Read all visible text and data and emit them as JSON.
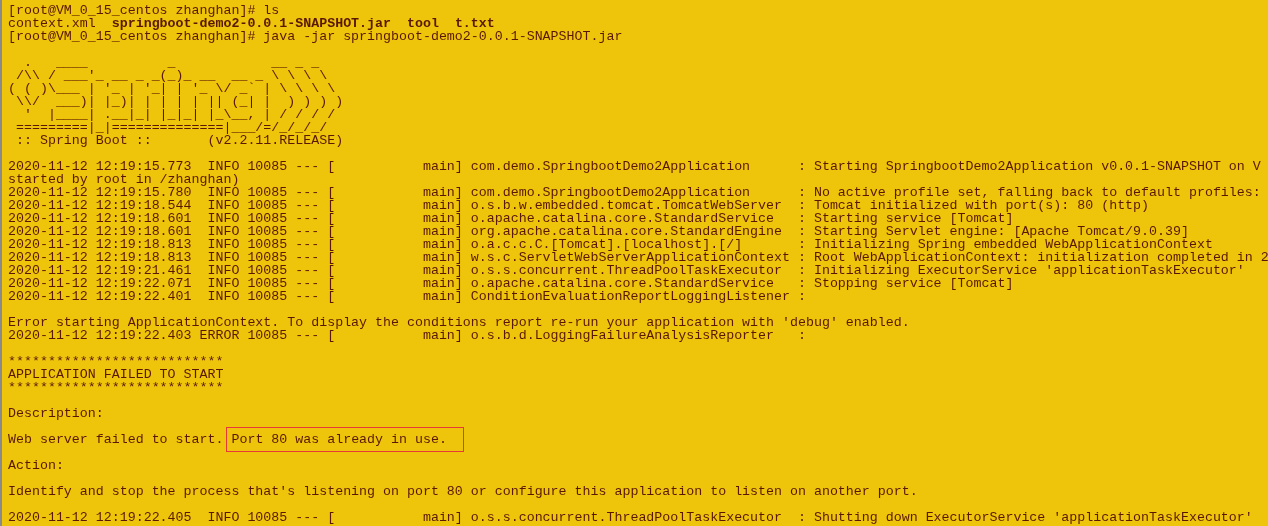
{
  "terminal": {
    "blocks": [
      {
        "lines": [
          {
            "text": "[root@VM_0_15_centos zhanghan]# ls"
          },
          {
            "text": "context.xml  **springboot-demo2-0.0.1-SNAPSHOT.jar**  **tool**  **t.txt**",
            "rich": true
          },
          {
            "text": "[root@VM_0_15_centos zhanghan]# java -jar springboot-demo2-0.0.1-SNAPSHOT.jar"
          }
        ]
      },
      {
        "lines": [
          {
            "text": "  .   ____          _            __ _ _"
          },
          {
            "text": " /\\\\ / ___'_ __ _ _(_)_ __  __ _ \\ \\ \\ \\"
          },
          {
            "text": "( ( )\\___ | '_ | '_| | '_ \\/ _` | \\ \\ \\ \\"
          },
          {
            "text": " \\\\/  ___)| |_)| | | | | || (_| |  ) ) ) )"
          },
          {
            "text": "  '  |____| .__|_| |_|_| |_\\__, | / / / /"
          },
          {
            "text": " =========|_|==============|___/=/_/_/_/"
          },
          {
            "text": " :: Spring Boot ::       (v2.2.11.RELEASE)"
          }
        ]
      },
      {
        "lines": [
          {
            "text": "2020-11-12 12:19:15.773  INFO 10085 --- [           main] com.demo.SpringbootDemo2Application      : Starting SpringbootDemo2Application v0.0.1-SNAPSHOT on V"
          },
          {
            "text": "started by root in /zhanghan)"
          },
          {
            "text": "2020-11-12 12:19:15.780  INFO 10085 --- [           main] com.demo.SpringbootDemo2Application      : No active profile set, falling back to default profiles:"
          },
          {
            "text": "2020-11-12 12:19:18.544  INFO 10085 --- [           main] o.s.b.w.embedded.tomcat.TomcatWebServer  : Tomcat initialized with port(s): 80 (http)"
          },
          {
            "text": "2020-11-12 12:19:18.601  INFO 10085 --- [           main] o.apache.catalina.core.StandardService   : Starting service [Tomcat]"
          },
          {
            "text": "2020-11-12 12:19:18.601  INFO 10085 --- [           main] org.apache.catalina.core.StandardEngine  : Starting Servlet engine: [Apache Tomcat/9.0.39]"
          },
          {
            "text": "2020-11-12 12:19:18.813  INFO 10085 --- [           main] o.a.c.c.C.[Tomcat].[localhost].[/]       : Initializing Spring embedded WebApplicationContext"
          },
          {
            "text": "2020-11-12 12:19:18.813  INFO 10085 --- [           main] w.s.c.ServletWebServerApplicationContext : Root WebApplicationContext: initialization completed in 2"
          },
          {
            "text": "2020-11-12 12:19:21.461  INFO 10085 --- [           main] o.s.s.concurrent.ThreadPoolTaskExecutor  : Initializing ExecutorService 'applicationTaskExecutor'"
          },
          {
            "text": "2020-11-12 12:19:22.071  INFO 10085 --- [           main] o.apache.catalina.core.StandardService   : Stopping service [Tomcat]"
          },
          {
            "text": "2020-11-12 12:19:22.401  INFO 10085 --- [           main] ConditionEvaluationReportLoggingListener :"
          }
        ]
      },
      {
        "lines": [
          {
            "text": "Error starting ApplicationContext. To display the conditions report re-run your application with 'debug' enabled."
          },
          {
            "text": "2020-11-12 12:19:22.403 ERROR 10085 --- [           main] o.s.b.d.LoggingFailureAnalysisReporter   :"
          }
        ]
      },
      {
        "lines": [
          {
            "text": "***************************"
          },
          {
            "text": "APPLICATION FAILED TO START"
          },
          {
            "text": "***************************"
          }
        ]
      },
      {
        "lines": [
          {
            "text": "Description:"
          }
        ]
      },
      {
        "lines": [
          {
            "text": "Web server failed to start. ",
            "boxed": "Port 80 was already in use."
          }
        ]
      },
      {
        "lines": [
          {
            "text": "Action:"
          }
        ]
      },
      {
        "lines": [
          {
            "text": "Identify and stop the process that's listening on port 80 or configure this application to listen on another port."
          }
        ]
      },
      {
        "lines": [
          {
            "text": "2020-11-12 12:19:22.405  INFO 10085 --- [           main] o.s.s.concurrent.ThreadPoolTaskExecutor  : Shutting down ExecutorService 'applicationTaskExecutor'"
          }
        ]
      }
    ]
  }
}
